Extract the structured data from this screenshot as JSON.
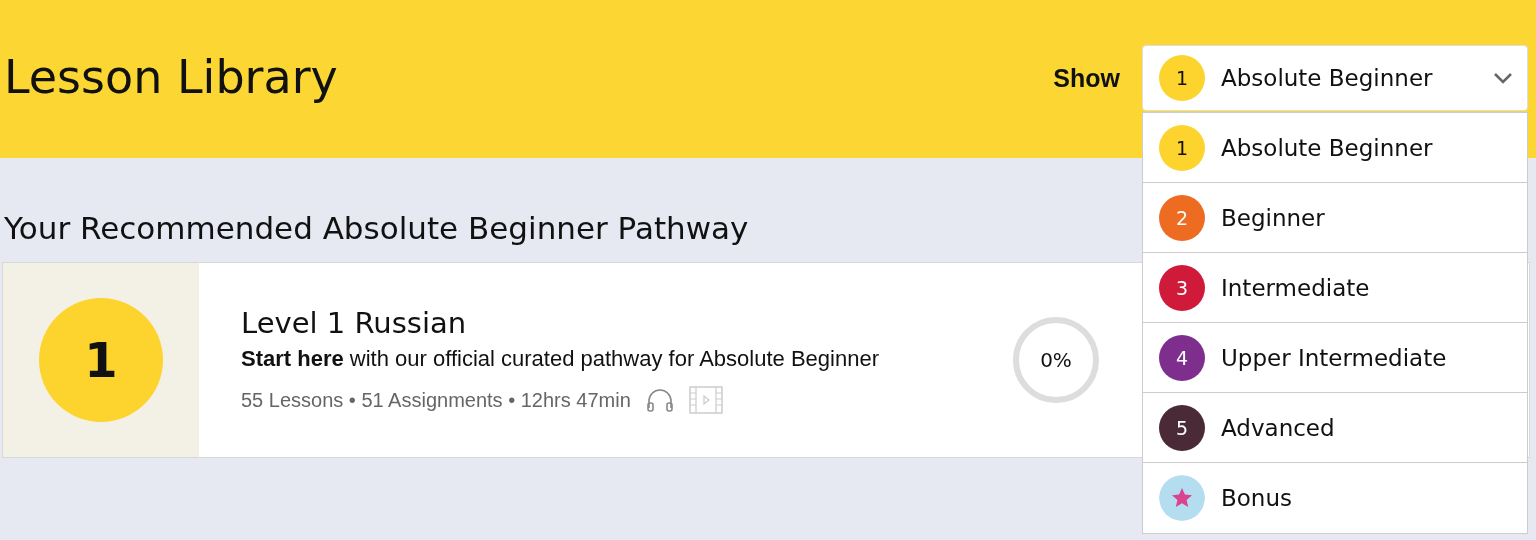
{
  "header": {
    "title": "Lesson Library",
    "show_label": "Show"
  },
  "level_select": {
    "badge": "1",
    "value": "Absolute Beginner",
    "color": "#fcd42d",
    "expanded": true
  },
  "level_options": [
    {
      "kind": "number",
      "badge": "1",
      "label": "Absolute Beginner",
      "color": "#fcd42d"
    },
    {
      "kind": "number",
      "badge": "2",
      "label": "Beginner",
      "color": "#ee6b22"
    },
    {
      "kind": "number",
      "badge": "3",
      "label": "Intermediate",
      "color": "#d01a3a"
    },
    {
      "kind": "number",
      "badge": "4",
      "label": "Upper Intermediate",
      "color": "#7e2f8e"
    },
    {
      "kind": "number",
      "badge": "5",
      "label": "Advanced",
      "color": "#4a2a37"
    },
    {
      "kind": "star",
      "label": "Bonus",
      "color": "#b4def0"
    }
  ],
  "pathway": {
    "heading": "Your Recommended Absolute Beginner Pathway",
    "card": {
      "badge": "1",
      "title": "Level 1 Russian",
      "description": "**Start here** with our official curated pathway for Absolute Beginner",
      "meta": "55 Lessons • 51 Assignments • 12hrs 47min",
      "progress": {
        "text": "0%",
        "level": 0
      }
    }
  }
}
